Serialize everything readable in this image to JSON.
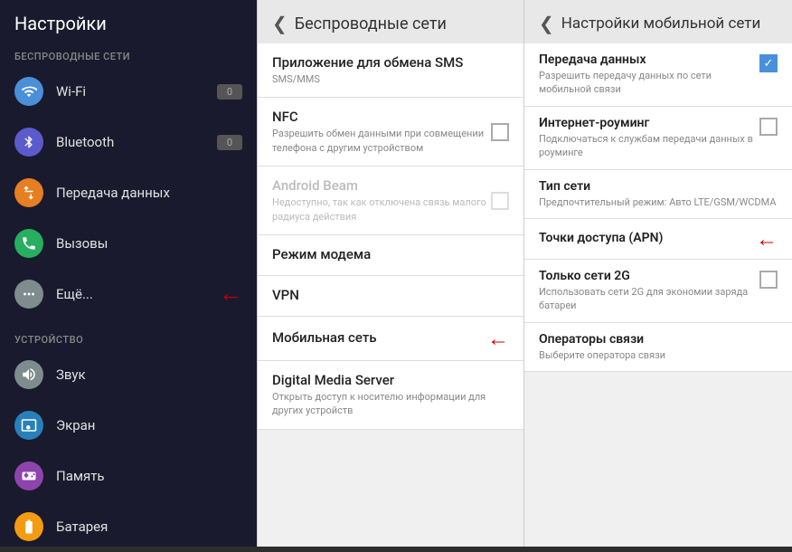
{
  "panel1": {
    "title": "Настройки",
    "section1": "БЕСПРОВОДНЫЕ СЕТИ",
    "items_wireless": [
      {
        "label": "Wi-Fi",
        "icon": "wifi",
        "iconClass": "icon-wifi",
        "hasToggle": true,
        "toggleVal": "0"
      },
      {
        "label": "Bluetooth",
        "icon": "bluetooth",
        "iconClass": "icon-bt",
        "hasToggle": true,
        "toggleVal": "0"
      },
      {
        "label": "Передача данных",
        "icon": "data",
        "iconClass": "icon-data",
        "hasToggle": false
      },
      {
        "label": "Вызовы",
        "icon": "calls",
        "iconClass": "icon-calls",
        "hasToggle": false
      },
      {
        "label": "Ещё...",
        "icon": "more",
        "iconClass": "icon-more",
        "hasToggle": false,
        "hasArrow": true
      }
    ],
    "section2": "УСТРОЙСТВО",
    "items_device": [
      {
        "label": "Звук",
        "icon": "sound",
        "iconClass": "icon-sound"
      },
      {
        "label": "Экран",
        "icon": "screen",
        "iconClass": "icon-screen"
      },
      {
        "label": "Память",
        "icon": "memory",
        "iconClass": "icon-memory"
      },
      {
        "label": "Батарея",
        "icon": "battery",
        "iconClass": "icon-battery"
      }
    ]
  },
  "panel2": {
    "back_label": "❮",
    "title": "Беспроводные сети",
    "items": [
      {
        "title": "Приложение для обмена SMS",
        "sub": "SMS/MMS",
        "hasCheckbox": false,
        "disabled": false
      },
      {
        "title": "NFC",
        "sub": "Разрешить обмен данными при совмещении телефона с другим устройством",
        "hasCheckbox": true,
        "disabled": false
      },
      {
        "title": "Android Beam",
        "sub": "Недоступно, так как отключена связь малого радиуса действия",
        "hasCheckbox": true,
        "disabled": true
      },
      {
        "title": "Режим модема",
        "sub": "",
        "hasCheckbox": false,
        "disabled": false
      },
      {
        "title": "VPN",
        "sub": "",
        "hasCheckbox": false,
        "disabled": false
      },
      {
        "title": "Мобильная сеть",
        "sub": "",
        "hasCheckbox": false,
        "disabled": false,
        "hasArrow": true
      },
      {
        "title": "Digital Media Server",
        "sub": "Открыть доступ к носителю информации для других устройств",
        "hasCheckbox": false,
        "disabled": false
      }
    ]
  },
  "panel3": {
    "back_label": "❮",
    "title": "Настройки мобильной сети",
    "items": [
      {
        "title": "Передача данных",
        "sub": "Разрешить передачу данных по сети мобильной связи",
        "hasCheckbox": true,
        "checked": true,
        "hasArrow": false
      },
      {
        "title": "Интернет-роуминг",
        "sub": "Подключаться к службам передачи данных в роуминге",
        "hasCheckbox": true,
        "checked": false,
        "hasArrow": false
      },
      {
        "title": "Тип сети",
        "sub": "Предпочтительный режим: Авто LTE/GSM/WCDMA",
        "hasCheckbox": false,
        "hasArrow": false
      },
      {
        "title": "Точки доступа (APN)",
        "sub": "",
        "hasCheckbox": false,
        "hasArrow": true
      },
      {
        "title": "Только сети 2G",
        "sub": "Использовать сети 2G для экономии заряда батареи",
        "hasCheckbox": true,
        "checked": false,
        "hasArrow": false
      },
      {
        "title": "Операторы связи",
        "sub": "Выберите оператора связи",
        "hasCheckbox": false,
        "hasArrow": false
      }
    ]
  },
  "icons": {
    "wifi": "📶",
    "bluetooth": "🔷",
    "data": "🔄",
    "calls": "📞",
    "more": "⋯",
    "sound": "🔊",
    "screen": "📱",
    "memory": "💾",
    "battery": "🔋"
  }
}
